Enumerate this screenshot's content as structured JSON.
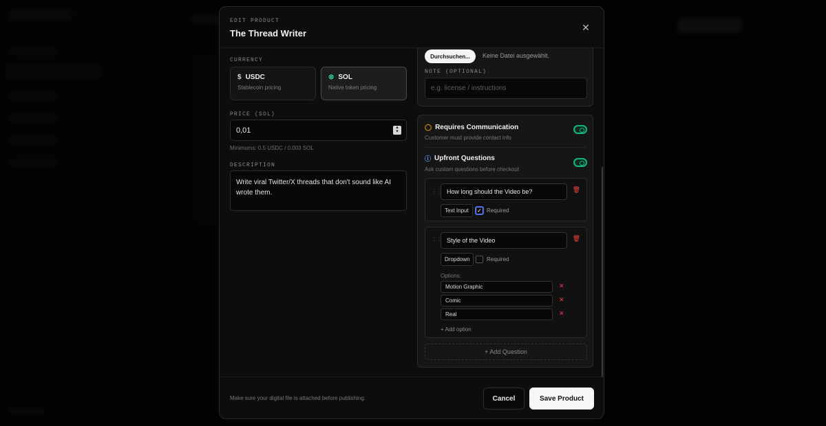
{
  "modal": {
    "eyebrow": "EDIT PRODUCT",
    "title": "The Thread Writer",
    "close_glyph": "✕"
  },
  "currency": {
    "label": "CURRENCY",
    "options": [
      {
        "title": "USDC",
        "subtitle": "Stablecoin pricing",
        "icon": "dollar-icon",
        "selected": false
      },
      {
        "title": "SOL",
        "subtitle": "Native token pricing",
        "icon": "solana-icon",
        "selected": true
      }
    ]
  },
  "price": {
    "label": "PRICE (SOL)",
    "value": "0,01",
    "minimums": "Minimums: 0.5 USDC / 0.003 SOL"
  },
  "description": {
    "label": "DESCRIPTION",
    "value": "Write viral Twitter/X threads that don't sound like AI wrote them.\n\nCreat..."
  },
  "file": {
    "browse_label": "Durchsuchen...",
    "no_file_text": "Keine Datei ausgewählt.",
    "note_label": "NOTE (OPTIONAL)",
    "note_placeholder": "e.g. license / instructions"
  },
  "settings": {
    "communication": {
      "title": "Requires Communication",
      "subtitle": "Customer must provide contact info",
      "enabled": true
    },
    "upfront": {
      "title": "Upfront Questions",
      "subtitle": "Ask custom questions before checkout",
      "enabled": true
    },
    "questions": [
      {
        "text": "How long should the Video be?",
        "type": "Text Input",
        "required": true,
        "required_label": "Required"
      },
      {
        "text": "Style of the Video",
        "type": "Dropdown",
        "required": false,
        "required_label": "Required",
        "options_label": "Options:",
        "options": [
          "Motion Graphic",
          "Comic",
          "Real"
        ],
        "add_option_label": "+ Add option"
      }
    ],
    "add_question_label": "+ Add Question"
  },
  "footer": {
    "note": "Make sure your digital file is attached before publishing.",
    "cancel_label": "Cancel",
    "save_label": "Save Product"
  }
}
